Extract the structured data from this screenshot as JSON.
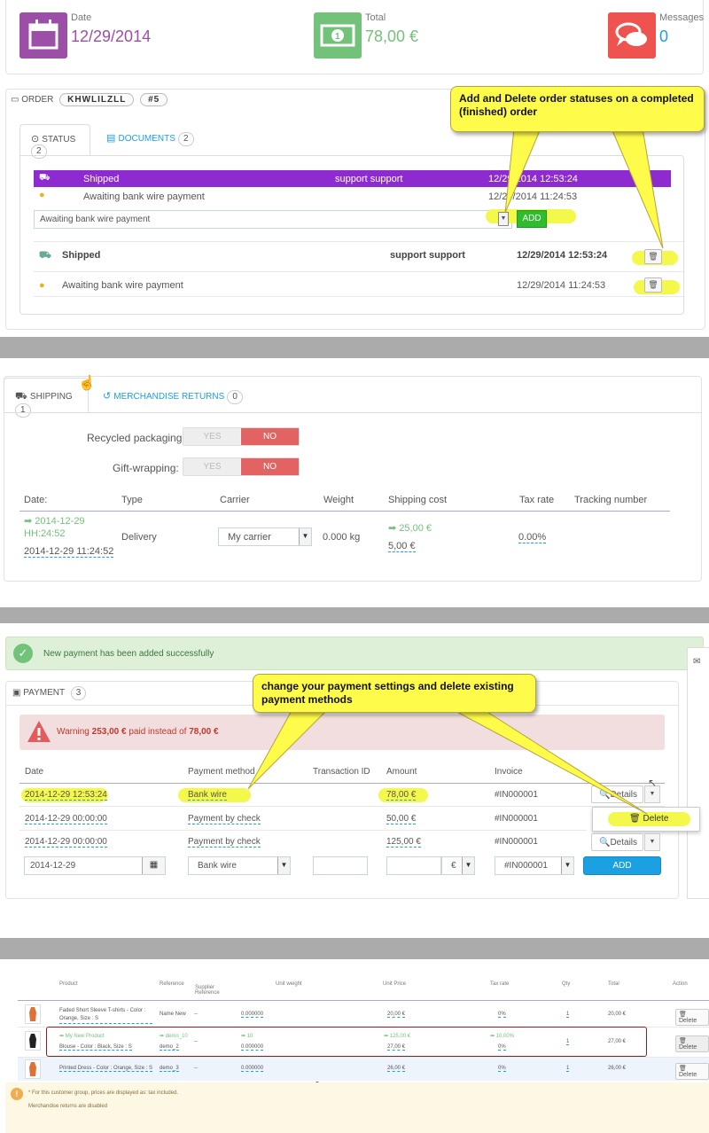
{
  "kpis": {
    "date": {
      "label": "Date",
      "value": "12/29/2014",
      "color": "#9c4fa7",
      "icon": "calendar-icon"
    },
    "total": {
      "label": "Total",
      "value": "78,00 €",
      "color": "#72c279",
      "icon": "money-icon"
    },
    "messages": {
      "label": "Messages",
      "value": "0",
      "color": "#ef5350",
      "icon": "chat-icon"
    }
  },
  "order": {
    "title": "ORDER",
    "reference": "KHWLILZLL",
    "number": "#5",
    "tabs": [
      {
        "label": "STATUS",
        "count": "2"
      },
      {
        "label": "DOCUMENTS",
        "count": "2"
      }
    ],
    "history": [
      {
        "status": "Shipped",
        "employee": "support support",
        "date": "12/29/2014 12:53:24"
      },
      {
        "status": "Awaiting bank wire payment",
        "employee": "",
        "date": "12/29/2014 11:24:53"
      }
    ],
    "status_select": "Awaiting bank wire payment",
    "add_label": "ADD",
    "status_rows": [
      {
        "status": "Shipped",
        "employee": "support support",
        "date": "12/29/2014 12:53:24"
      },
      {
        "status": "Awaiting bank wire payment",
        "employee": "",
        "date": "12/29/2014 11:24:53"
      }
    ],
    "callout": "Add and Delete order statuses on a completed (finished) order",
    "accent": "#8e2bd0"
  },
  "shipping": {
    "tabs": [
      {
        "label": "SHIPPING",
        "count": "1"
      },
      {
        "label": "MERCHANDISE RETURNS",
        "count": "0"
      }
    ],
    "recycled_label": "Recycled packaging:",
    "gift_label": "Gift-wrapping:",
    "yes": "YES",
    "no": "NO",
    "columns": [
      "Date:",
      "Type",
      "Carrier",
      "Weight",
      "Shipping cost",
      "Tax rate",
      "Tracking number"
    ],
    "row": {
      "date_new": "2014-12-29",
      "time_new": "HH:24:52",
      "date_old": "2014-12-29 11:24:52",
      "type": "Delivery",
      "carrier": "My carrier",
      "weight": "0.000 kg",
      "cost_new": "25,00 €",
      "cost_old": "5,00 €",
      "tax": "0.00%"
    }
  },
  "payment": {
    "success": "New payment has been added successfully",
    "title": "PAYMENT",
    "count": "3",
    "warning_prefix": "Warning",
    "warning_paid": "253,00 €",
    "warning_mid": "paid instead of",
    "warning_total": "78,00 €",
    "columns": [
      "Date",
      "Payment method",
      "Transaction ID",
      "Amount",
      "Invoice"
    ],
    "rows": [
      {
        "date": "2014-12-29 12:53:24",
        "method": "Bank wire",
        "amount": "78,00 €",
        "invoice": "#IN000001"
      },
      {
        "date": "2014-12-29 00:00:00",
        "method": "Payment by check",
        "amount": "50,00 €",
        "invoice": "#IN000001"
      },
      {
        "date": "2014-12-29 00:00:00",
        "method": "Payment by check",
        "amount": "125,00 €",
        "invoice": "#IN000001"
      }
    ],
    "details_label": "Details",
    "delete_label": "Delete",
    "form": {
      "date": "2014-12-29",
      "method": "Bank wire",
      "currency": "€",
      "invoice": "#IN000001",
      "add": "ADD"
    },
    "callout": "change your payment settings and delete existing payment methods"
  },
  "products": {
    "header_labels": [
      "Product",
      "Reference",
      "Supplier Reference",
      "Unit weight",
      "Unit Price",
      "Tax rate",
      "Qty",
      "Total",
      "Action"
    ],
    "rows": [
      {
        "name": "Faded Short Sleeve T-shirts - Color : Orange, Size : S",
        "ref": "Name New",
        "sref": "--",
        "weight": "0.000000",
        "price": "20,00 €",
        "tax": "0%",
        "qty": "1",
        "total": "20,00 €"
      },
      {
        "name_new": "My New Product",
        "name": "Blouse - Color : Black, Size : S",
        "ref_new": "demo_10",
        "ref": "demo_2",
        "sref": "--",
        "weight_new": "10",
        "weight": "0.000000",
        "price_new": "125,00 €",
        "price": "27,00 €",
        "tax_new": "10,00%",
        "tax": "0%",
        "qty": "1",
        "total": "27,00 €"
      },
      {
        "name": "Printed Dress - Color : Orange, Size : S",
        "ref": "demo_3",
        "sref": "--",
        "weight": "0.000000",
        "price": "26,00 €",
        "tax": "0%",
        "qty": "1",
        "total": "26,00 €"
      }
    ],
    "delete_label": "Delete",
    "note1": "For this customer group, prices are displayed as: tax included.",
    "note2": "Merchandise returns are disabled"
  }
}
